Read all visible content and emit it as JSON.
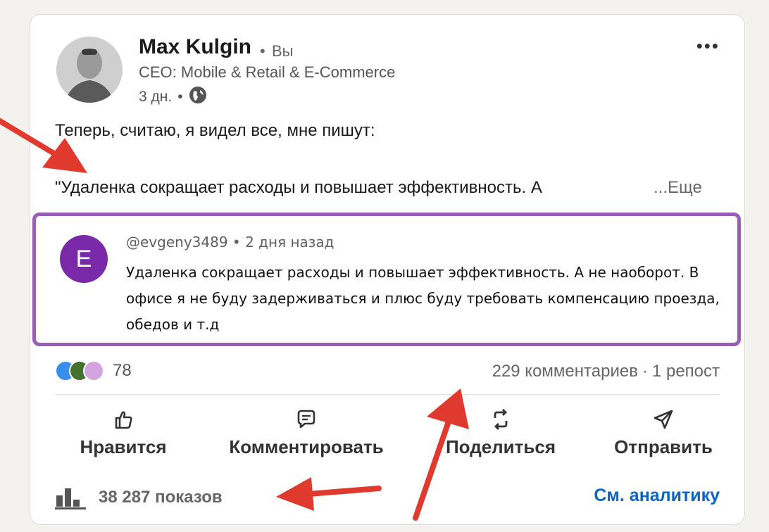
{
  "post": {
    "author_name": "Max Kulgin",
    "you_badge": "Вы",
    "headline": "CEO: Mobile & Retail & E-Commerce",
    "time": "3 дн.",
    "line1": "Теперь, считаю, я видел все, мне пишут:",
    "line2": "\"Удаленка сокращает расходы и повышает эффективность. А",
    "see_more": "...Еще"
  },
  "embedded_comment": {
    "avatar_letter": "E",
    "username": "@evgeny3489",
    "time": "2 дня назад",
    "text": "Удаленка сокращает расходы и повышает эффективность. А не наоборот.  В офисе я не буду задерживаться и плюс буду требовать компенсацию проезда, обедов и т.д"
  },
  "social": {
    "reactions_count": "78",
    "comments": "229 комментариев",
    "reposts": "1 репост"
  },
  "actions": {
    "like": "Нравится",
    "comment": "Комментировать",
    "share": "Поделиться",
    "send": "Отправить"
  },
  "footer": {
    "impressions": "38 287 показов",
    "analytics_link": "См. аналитику"
  },
  "icons": [
    "more-icon",
    "globe-icon",
    "like-icon",
    "comment-icon",
    "repost-icon",
    "send-icon",
    "bar-chart-icon"
  ],
  "colors": {
    "accent": "#0a66c2",
    "frame": "#9a5db7",
    "arrow": "#e03a2f",
    "comment_avatar": "#7a2aa8"
  }
}
